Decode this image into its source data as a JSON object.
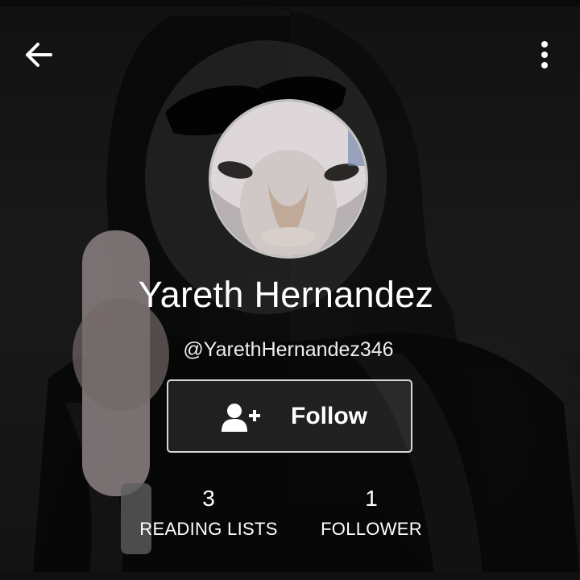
{
  "profile": {
    "name": "Yareth Hernandez",
    "handle": "@YarethHernandez346"
  },
  "follow_button": {
    "label": "Follow",
    "icon": "add-user-icon"
  },
  "stats": [
    {
      "count": "3",
      "label": "READING LISTS"
    },
    {
      "count": "1",
      "label": "FOLLOWER"
    }
  ],
  "toolbar": {
    "back_icon": "arrow-left-icon",
    "more_icon": "more-vertical-icon"
  }
}
